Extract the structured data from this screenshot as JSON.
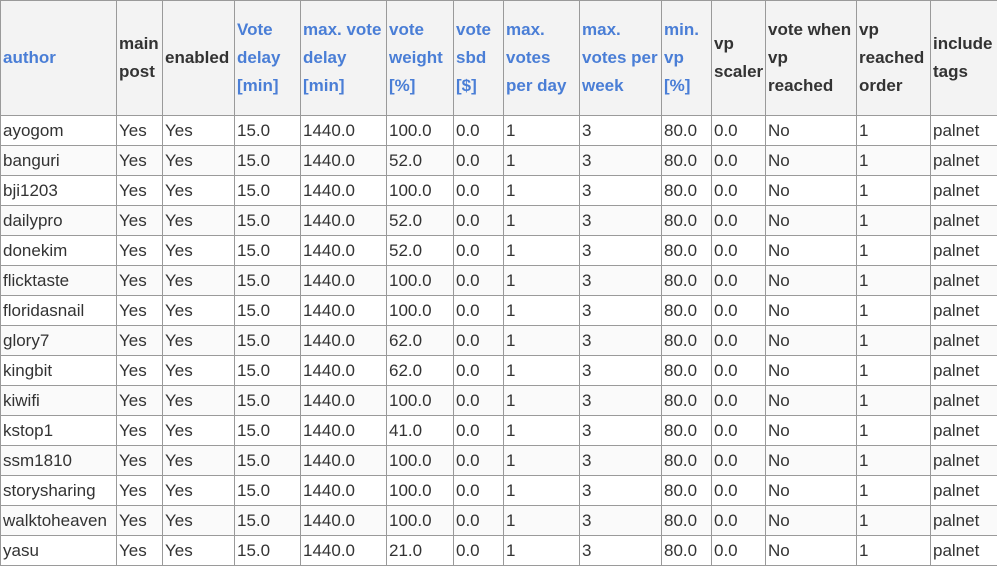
{
  "table": {
    "columns": [
      {
        "key": "author",
        "label": "author",
        "sortable": true
      },
      {
        "key": "main_post",
        "label": "main post",
        "sortable": false
      },
      {
        "key": "enabled",
        "label": "enabled",
        "sortable": false
      },
      {
        "key": "vote_delay",
        "label": "Vote delay [min]",
        "sortable": true
      },
      {
        "key": "max_vote_delay",
        "label": "max. vote delay [min]",
        "sortable": true
      },
      {
        "key": "vote_weight",
        "label": "vote weight [%]",
        "sortable": true
      },
      {
        "key": "vote_sbd",
        "label": "vote sbd [$]",
        "sortable": true
      },
      {
        "key": "max_votes_per_day",
        "label": "max. votes per day",
        "sortable": true
      },
      {
        "key": "max_votes_per_week",
        "label": "max. votes per week",
        "sortable": true
      },
      {
        "key": "min_vp",
        "label": "min. vp [%]",
        "sortable": true
      },
      {
        "key": "vp_scaler",
        "label": "vp scaler",
        "sortable": false
      },
      {
        "key": "vote_when_vp_reached",
        "label": "vote when vp reached",
        "sortable": false
      },
      {
        "key": "vp_reached_order",
        "label": "vp reached order",
        "sortable": false
      },
      {
        "key": "include_tags",
        "label": "include tags",
        "sortable": false
      }
    ],
    "rows": [
      [
        "ayogom",
        "Yes",
        "Yes",
        "15.0",
        "1440.0",
        "100.0",
        "0.0",
        "1",
        "3",
        "80.0",
        "0.0",
        "No",
        "1",
        "palnet"
      ],
      [
        "banguri",
        "Yes",
        "Yes",
        "15.0",
        "1440.0",
        "52.0",
        "0.0",
        "1",
        "3",
        "80.0",
        "0.0",
        "No",
        "1",
        "palnet"
      ],
      [
        "bji1203",
        "Yes",
        "Yes",
        "15.0",
        "1440.0",
        "100.0",
        "0.0",
        "1",
        "3",
        "80.0",
        "0.0",
        "No",
        "1",
        "palnet"
      ],
      [
        "dailypro",
        "Yes",
        "Yes",
        "15.0",
        "1440.0",
        "52.0",
        "0.0",
        "1",
        "3",
        "80.0",
        "0.0",
        "No",
        "1",
        "palnet"
      ],
      [
        "donekim",
        "Yes",
        "Yes",
        "15.0",
        "1440.0",
        "52.0",
        "0.0",
        "1",
        "3",
        "80.0",
        "0.0",
        "No",
        "1",
        "palnet"
      ],
      [
        "flicktaste",
        "Yes",
        "Yes",
        "15.0",
        "1440.0",
        "100.0",
        "0.0",
        "1",
        "3",
        "80.0",
        "0.0",
        "No",
        "1",
        "palnet"
      ],
      [
        "floridasnail",
        "Yes",
        "Yes",
        "15.0",
        "1440.0",
        "100.0",
        "0.0",
        "1",
        "3",
        "80.0",
        "0.0",
        "No",
        "1",
        "palnet"
      ],
      [
        "glory7",
        "Yes",
        "Yes",
        "15.0",
        "1440.0",
        "62.0",
        "0.0",
        "1",
        "3",
        "80.0",
        "0.0",
        "No",
        "1",
        "palnet"
      ],
      [
        "kingbit",
        "Yes",
        "Yes",
        "15.0",
        "1440.0",
        "62.0",
        "0.0",
        "1",
        "3",
        "80.0",
        "0.0",
        "No",
        "1",
        "palnet"
      ],
      [
        "kiwifi",
        "Yes",
        "Yes",
        "15.0",
        "1440.0",
        "100.0",
        "0.0",
        "1",
        "3",
        "80.0",
        "0.0",
        "No",
        "1",
        "palnet"
      ],
      [
        "kstop1",
        "Yes",
        "Yes",
        "15.0",
        "1440.0",
        "41.0",
        "0.0",
        "1",
        "3",
        "80.0",
        "0.0",
        "No",
        "1",
        "palnet"
      ],
      [
        "ssm1810",
        "Yes",
        "Yes",
        "15.0",
        "1440.0",
        "100.0",
        "0.0",
        "1",
        "3",
        "80.0",
        "0.0",
        "No",
        "1",
        "palnet"
      ],
      [
        "storysharing",
        "Yes",
        "Yes",
        "15.0",
        "1440.0",
        "100.0",
        "0.0",
        "1",
        "3",
        "80.0",
        "0.0",
        "No",
        "1",
        "palnet"
      ],
      [
        "walktoheaven",
        "Yes",
        "Yes",
        "15.0",
        "1440.0",
        "100.0",
        "0.0",
        "1",
        "3",
        "80.0",
        "0.0",
        "No",
        "1",
        "palnet"
      ],
      [
        "yasu",
        "Yes",
        "Yes",
        "15.0",
        "1440.0",
        "21.0",
        "0.0",
        "1",
        "3",
        "80.0",
        "0.0",
        "No",
        "1",
        "palnet"
      ]
    ]
  }
}
